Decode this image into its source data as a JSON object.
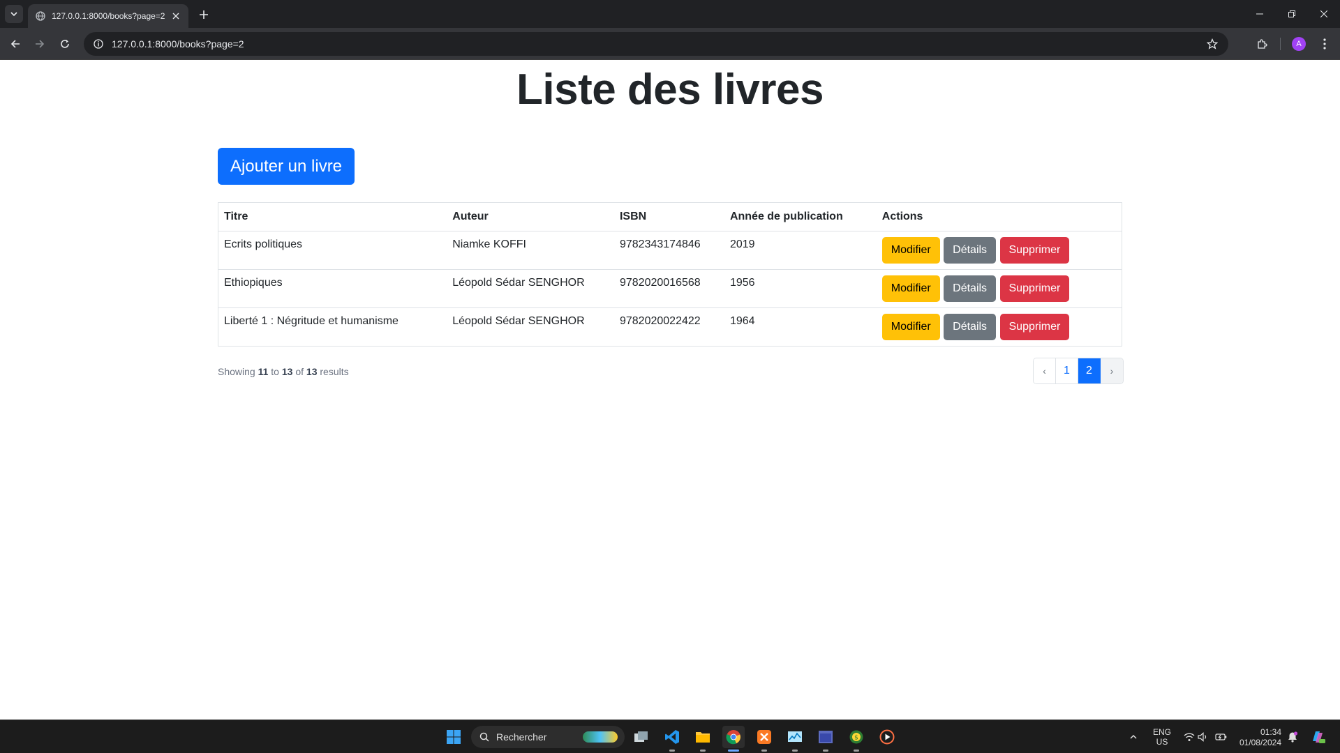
{
  "browser": {
    "tab_title": "127.0.0.1:8000/books?page=2",
    "url": "127.0.0.1:8000/books?page=2",
    "profile_initial": "A"
  },
  "page": {
    "title": "Liste des livres",
    "add_button": "Ajouter un livre",
    "columns": [
      "Titre",
      "Auteur",
      "ISBN",
      "Année de publication",
      "Actions"
    ],
    "rows": [
      {
        "title": "Ecrits politiques",
        "author": "Niamke KOFFI",
        "isbn": "9782343174846",
        "year": "2019"
      },
      {
        "title": "Ethiopiques",
        "author": "Léopold Sédar SENGHOR",
        "isbn": "9782020016568",
        "year": "1956"
      },
      {
        "title": "Liberté 1 : Négritude et humanisme",
        "author": "Léopold Sédar SENGHOR",
        "isbn": "9782020022422",
        "year": "1964"
      }
    ],
    "action_labels": {
      "edit": "Modifier",
      "details": "Détails",
      "delete": "Supprimer"
    },
    "showing": {
      "prefix": "Showing",
      "from": "11",
      "to_word": "to",
      "to": "13",
      "of_word": "of",
      "total": "13",
      "suffix": "results"
    },
    "pagination": {
      "prev": "‹",
      "pages": [
        "1",
        "2"
      ],
      "current": "2",
      "next": "›"
    }
  },
  "taskbar": {
    "search_placeholder": "Rechercher",
    "lang_line1": "ENG",
    "lang_line2": "US",
    "time": "01:34",
    "date": "01/08/2024"
  },
  "colors": {
    "primary": "#0d6efd",
    "warning": "#ffc107",
    "secondary": "#6c757d",
    "danger": "#dc3545"
  }
}
